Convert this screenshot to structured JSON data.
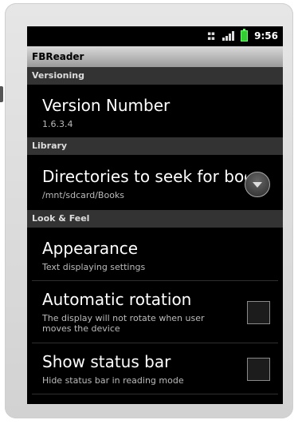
{
  "status_bar": {
    "time": "9:56",
    "icons": [
      "sim-icon",
      "signal-icon",
      "battery-icon"
    ]
  },
  "app": {
    "title": "FBReader"
  },
  "sections": {
    "versioning": "Versioning",
    "library": "Library",
    "look_and_feel": "Look & Feel"
  },
  "prefs": {
    "version": {
      "title": "Version Number",
      "summary": "1.6.3.4"
    },
    "directories": {
      "title": "Directories to seek for books",
      "summary": "/mnt/sdcard/Books"
    },
    "appearance": {
      "title": "Appearance",
      "summary": "Text displaying settings"
    },
    "rotation": {
      "title": "Automatic rotation",
      "summary": "The display will not rotate when user moves the device",
      "checked": false
    },
    "status_bar": {
      "title": "Show status bar",
      "summary": "Hide status bar in reading mode",
      "checked": false
    }
  }
}
